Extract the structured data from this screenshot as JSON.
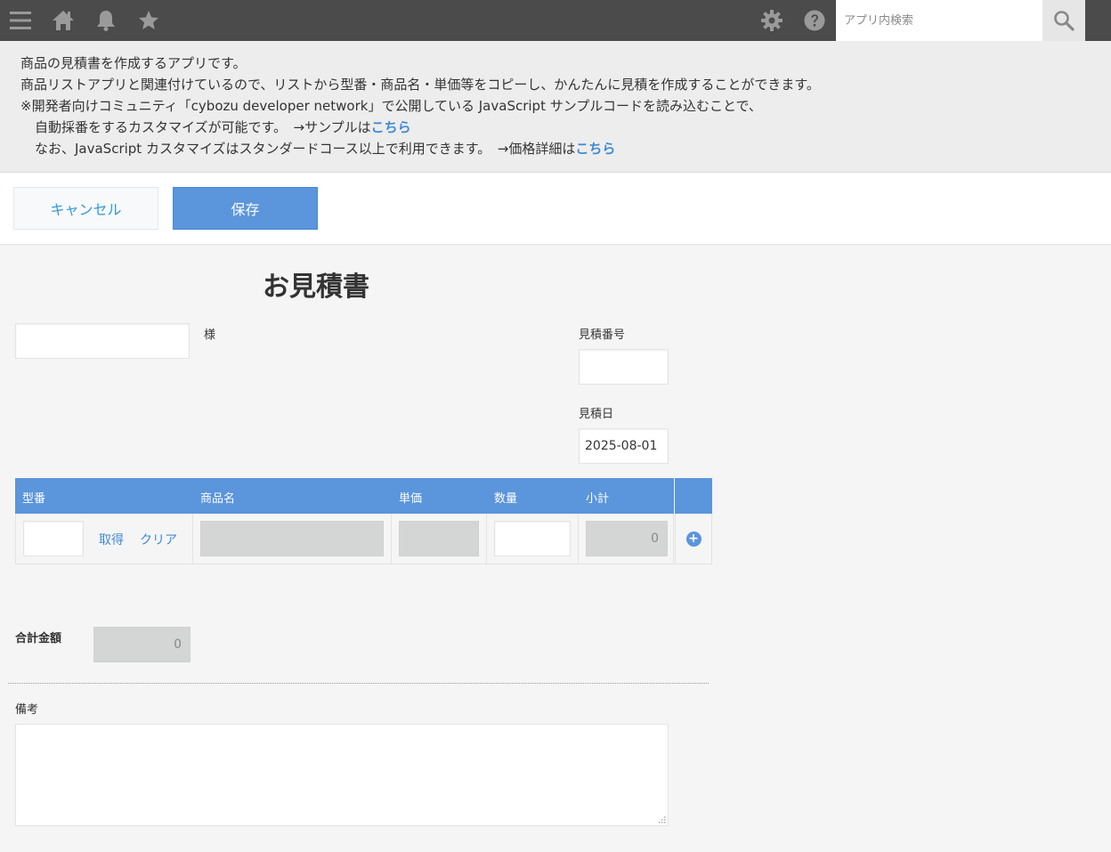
{
  "header": {
    "icons": [
      "menu-icon",
      "home-icon",
      "bell-icon",
      "star-icon",
      "gear-icon",
      "help-icon",
      "search-icon"
    ],
    "search_placeholder": "アプリ内検索"
  },
  "description": {
    "line1": "商品の見積書を作成するアプリです。",
    "line2": "商品リストアプリと関連付けているので、リストから型番・商品名・単価等をコピーし、かんたんに見積を作成することができます。",
    "line3": "※開発者向けコミュニティ「cybozu developer network」で公開している JavaScript サンプルコードを読み込むことで、",
    "line4_text": "自動採番をするカスタマイズが可能です。　→サンプルは",
    "line4_link": "こちら",
    "line5_text": "なお、JavaScript カスタマイズはスタンダードコース以上で利用できます。　→価格詳細は",
    "line5_link": "こちら"
  },
  "toolbar": {
    "cancel_label": "キャンセル",
    "save_label": "保存"
  },
  "form": {
    "title": "お見積書",
    "customer_suffix": "様",
    "customer_value": "",
    "quote_number_label": "見積番号",
    "quote_number_value": "",
    "quote_date_label": "見積日",
    "quote_date_value": "2025-08-01",
    "table": {
      "columns": [
        "型番",
        "商品名",
        "単価",
        "数量",
        "小計"
      ],
      "row": {
        "model_value": "",
        "fetch_label": "取得",
        "clear_label": "クリア",
        "product_name": "",
        "unit_price": "",
        "quantity": "",
        "subtotal": "0"
      }
    },
    "total_label": "合計金額",
    "total_value": "0",
    "remarks_label": "備考",
    "remarks_value": ""
  },
  "colors": {
    "header_bg": "#4b4b4b",
    "accent": "#5b95dc",
    "link": "#3f8ad6"
  }
}
